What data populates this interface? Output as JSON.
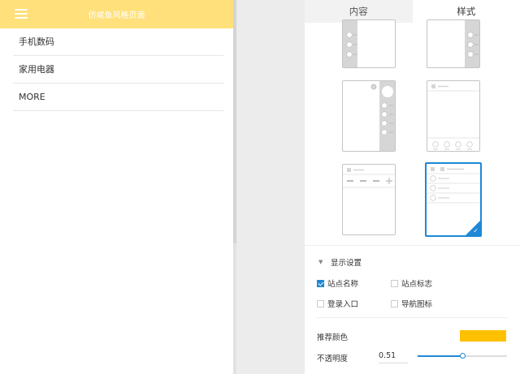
{
  "preview": {
    "title": "仿咸鱼风格页面",
    "items": [
      {
        "label": "手机数码"
      },
      {
        "label": "家用电器"
      },
      {
        "label": "MORE"
      }
    ]
  },
  "panel": {
    "tabs": [
      {
        "label": "内容",
        "active": false
      },
      {
        "label": "样式",
        "active": true
      }
    ],
    "display_settings": {
      "label": "显示设置",
      "options": [
        {
          "label": "站点名称",
          "checked": true
        },
        {
          "label": "站点标志",
          "checked": false
        },
        {
          "label": "登录入口",
          "checked": false
        },
        {
          "label": "导航图标",
          "checked": false
        }
      ]
    },
    "recommend_color": {
      "label": "推荐颜色",
      "value": "#ffc000"
    },
    "opacity": {
      "label": "不透明度",
      "value": "0.51",
      "fraction": 0.51
    }
  },
  "colors": {
    "header": "#ffe07a",
    "accent": "#1f88d6",
    "thumb_gray": "#d6d6d6"
  },
  "icons": [
    "menu-icon",
    "triangle-down-icon",
    "check-icon"
  ]
}
